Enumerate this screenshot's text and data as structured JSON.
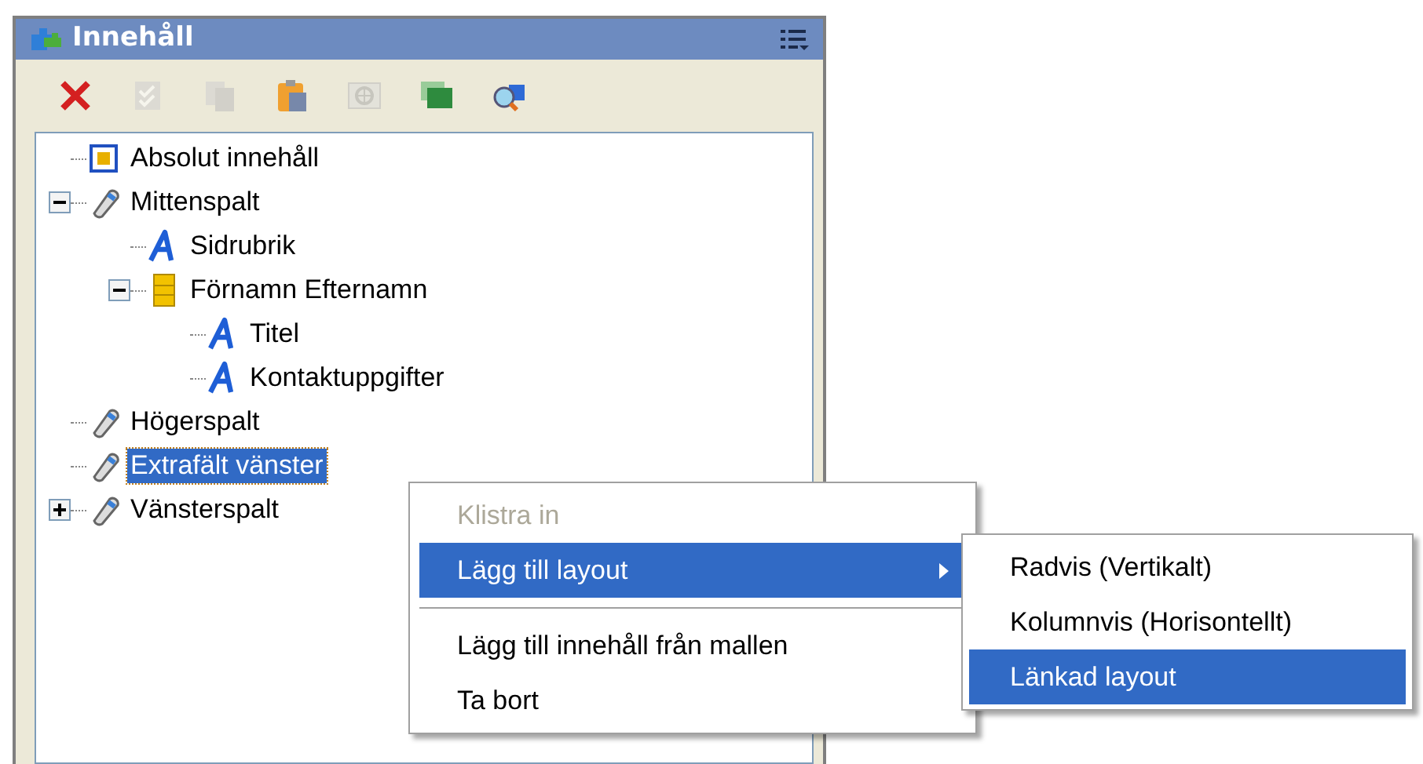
{
  "panel": {
    "title": "Innehåll"
  },
  "toolbar": [
    {
      "kind": "delete",
      "disabled": false
    },
    {
      "kind": "check",
      "disabled": true
    },
    {
      "kind": "copy",
      "disabled": true
    },
    {
      "kind": "paste",
      "disabled": false
    },
    {
      "kind": "move",
      "disabled": true
    },
    {
      "kind": "layers",
      "disabled": false
    },
    {
      "kind": "preview",
      "disabled": false
    }
  ],
  "tree": [
    {
      "label": "Absolut innehåll",
      "kind": "absolute",
      "selected": false
    },
    {
      "label": "Mittenspalt",
      "kind": "column",
      "selected": false,
      "expanded": true,
      "children": [
        {
          "label": "Sidrubrik",
          "kind": "text",
          "selected": false
        },
        {
          "label": "Förnamn Efternamn",
          "kind": "group",
          "selected": false,
          "expanded": true,
          "children": [
            {
              "label": "Titel",
              "kind": "text",
              "selected": false
            },
            {
              "label": "Kontaktuppgifter",
              "kind": "text",
              "selected": false
            }
          ]
        }
      ]
    },
    {
      "label": "Högerspalt",
      "kind": "column",
      "selected": false
    },
    {
      "label": "Extrafält vänster",
      "kind": "column",
      "selected": true
    },
    {
      "label": "Vänsterspalt",
      "kind": "column",
      "selected": false,
      "expanded": false
    }
  ],
  "context_menu": [
    {
      "kind": "item",
      "label": "Klistra in",
      "disabled": true,
      "selected": false
    },
    {
      "kind": "item",
      "label": "Lägg till layout",
      "disabled": false,
      "selected": true,
      "submenu": true
    },
    {
      "kind": "separator"
    },
    {
      "kind": "item",
      "label": "Lägg till innehåll från mallen",
      "disabled": false,
      "selected": false
    },
    {
      "kind": "item",
      "label": "Ta bort",
      "disabled": false,
      "selected": false
    }
  ],
  "submenu": [
    {
      "label": "Radvis (Vertikalt)",
      "selected": false
    },
    {
      "label": "Kolumnvis (Horisontellt)",
      "selected": false
    },
    {
      "label": "Länkad layout",
      "selected": true
    }
  ]
}
